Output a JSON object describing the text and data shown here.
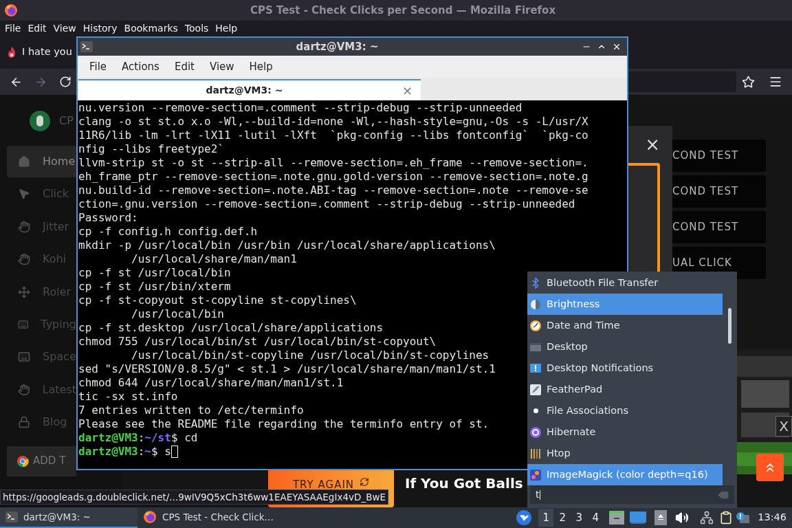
{
  "browser": {
    "title": "CPS Test - Check Clicks per Second — Mozilla Firefox",
    "menu": [
      "File",
      "Edit",
      "View",
      "History",
      "Bookmarks",
      "Tools",
      "Help"
    ],
    "tab": {
      "label": "I hate you"
    },
    "nav": {
      "forward_disabled": true
    },
    "site": {
      "logo_text": "CP",
      "sidebar": [
        {
          "label": "Home",
          "selected": true,
          "kind": "home"
        },
        {
          "label": "Click",
          "selected": false,
          "kind": "pointer"
        },
        {
          "label": "Jitter",
          "selected": false,
          "kind": "hand"
        },
        {
          "label": "Kohi",
          "selected": false,
          "kind": "hand"
        },
        {
          "label": "Roler",
          "selected": false,
          "kind": "move"
        },
        {
          "label": "Typing",
          "selected": false,
          "kind": "keyboard"
        },
        {
          "label": "Space",
          "selected": false,
          "kind": "keyboard"
        },
        {
          "label": "Latest",
          "selected": false,
          "kind": "hand"
        },
        {
          "label": "Blog",
          "selected": false,
          "kind": "lock"
        }
      ],
      "add_button": "ADD T",
      "tests": [
        "COND TEST",
        "COND TEST",
        "COND TEST",
        "UAL CLICK"
      ],
      "modal_close": "×",
      "ad_close": "X",
      "try_again": "TRY AGAIN",
      "headline": "If You Got Balls"
    },
    "status_url": "https://googleads.g.doubleclick.net/...9wIV9Q5xCh3t6ww1EAEYASAAEgIx4vD_BwE"
  },
  "terminal": {
    "title": "dartz@VM3: ~",
    "menu": [
      "File",
      "Actions",
      "Edit",
      "View",
      "Help"
    ],
    "tab": {
      "label": "dartz@VM3: ~",
      "close": "×"
    },
    "lines": [
      {
        "kind": "out",
        "text": "nu.version --remove-section=.comment --strip-debug --strip-unneeded"
      },
      {
        "kind": "out",
        "text": "clang -o st st.o x.o -Wl,--build-id=none -Wl,--hash-style=gnu,-Os -s -L/usr/X"
      },
      {
        "kind": "out",
        "text": "11R6/lib -lm -lrt -lX11 -lutil -lXft  `pkg-config --libs fontconfig`  `pkg-co"
      },
      {
        "kind": "out",
        "text": "nfig --libs freetype2`"
      },
      {
        "kind": "out",
        "text": "llvm-strip st -o st --strip-all --remove-section=.eh_frame --remove-section=."
      },
      {
        "kind": "out",
        "text": "eh_frame_ptr --remove-section=.note.gnu.gold-version --remove-section=.note.g"
      },
      {
        "kind": "out",
        "text": "nu.build-id --remove-section=.note.ABI-tag --remove-section=.note --remove-se"
      },
      {
        "kind": "out",
        "text": "ction=.gnu.version --remove-section=.comment --strip-debug --strip-unneeded"
      },
      {
        "kind": "out",
        "text": "Password:"
      },
      {
        "kind": "out",
        "text": "cp -f config.h config.def.h"
      },
      {
        "kind": "out",
        "text": "mkdir -p /usr/local/bin /usr/bin /usr/local/share/applications\\"
      },
      {
        "kind": "out",
        "text": "        /usr/local/share/man/man1"
      },
      {
        "kind": "out",
        "text": "cp -f st /usr/local/bin"
      },
      {
        "kind": "out",
        "text": "cp -f st /usr/bin/xterm"
      },
      {
        "kind": "out",
        "text": "cp -f st-copyout st-copyline st-copylines\\"
      },
      {
        "kind": "out",
        "text": "        /usr/local/bin"
      },
      {
        "kind": "out",
        "text": "cp -f st.desktop /usr/local/share/applications"
      },
      {
        "kind": "out",
        "text": "chmod 755 /usr/local/bin/st /usr/local/bin/st-copyout\\"
      },
      {
        "kind": "out",
        "text": "        /usr/local/bin/st-copyline /usr/local/bin/st-copylines"
      },
      {
        "kind": "out",
        "text": "sed \"s/VERSION/0.8.5/g\" < st.1 > /usr/local/share/man/man1/st.1"
      },
      {
        "kind": "out",
        "text": "chmod 644 /usr/local/share/man/man1/st.1"
      },
      {
        "kind": "out",
        "text": "tic -sx st.info"
      },
      {
        "kind": "out",
        "text": "7 entries written to /etc/terminfo"
      },
      {
        "kind": "out",
        "text": "Please see the README file regarding the terminfo entry of st."
      },
      {
        "kind": "prompt",
        "user": "dartz@VM3",
        "sep": ":",
        "path": "~/st",
        "symbol": "$",
        "command": "cd",
        "cursor": false
      },
      {
        "kind": "prompt",
        "user": "dartz@VM3",
        "sep": ":",
        "path": "~",
        "symbol": "$",
        "command": "s",
        "cursor": true
      }
    ]
  },
  "app_menu": {
    "items": [
      {
        "label": "Bluetooth File Transfer",
        "kind": "bluetooth",
        "selected": false
      },
      {
        "label": "Brightness",
        "kind": "brightness",
        "selected": true
      },
      {
        "label": "Date and Time",
        "kind": "clock",
        "selected": false
      },
      {
        "label": "Desktop",
        "kind": "desktop",
        "selected": false
      },
      {
        "label": "Desktop Notifications",
        "kind": "notify",
        "selected": false
      },
      {
        "label": "FeatherPad",
        "kind": "feather",
        "selected": false
      },
      {
        "label": "File Associations",
        "kind": "dot",
        "selected": false
      },
      {
        "label": "Hibernate",
        "kind": "hibernate",
        "selected": false
      },
      {
        "label": "Htop",
        "kind": "htop",
        "selected": false
      },
      {
        "label": "ImageMagick (color depth=q16)",
        "kind": "magick",
        "selected": true
      }
    ],
    "search": {
      "value": "t"
    }
  },
  "taskbar": {
    "tasks": [
      {
        "label": "dartz@VM3: ~",
        "kind": "terminal",
        "selected": true
      },
      {
        "label": "CPS Test - Check Click…",
        "kind": "firefox",
        "selected": false
      }
    ],
    "workspaces": [
      {
        "label": "1",
        "selected": true
      },
      {
        "label": "2",
        "selected": false
      },
      {
        "label": "3",
        "selected": false
      },
      {
        "label": "4",
        "selected": false
      }
    ],
    "clock": "13:46"
  }
}
